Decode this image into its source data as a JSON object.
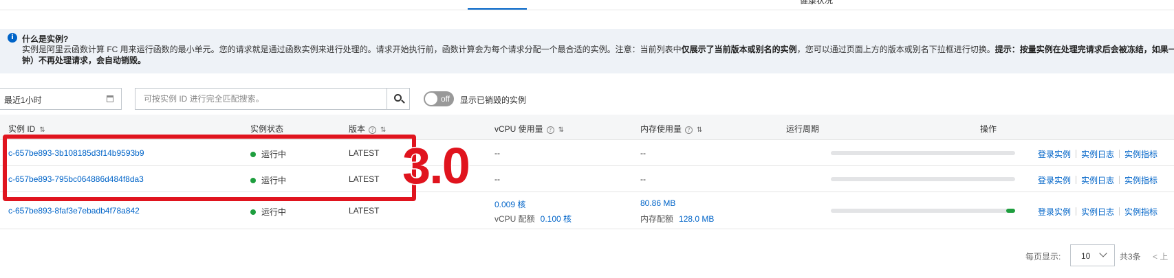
{
  "top_tabs": {
    "partial_label": "健康状况"
  },
  "info": {
    "icon": "info-icon",
    "title": "什么是实例?",
    "line1_a": "实例是阿里云函数计算 FC 用来运行函数的最小单元。您的请求就是通过函数实例来进行处理的。请求开始执行前，函数计算会为每个请求分配一个最合适的实例。注意：当前列表中",
    "line1_b": "仅展示了当前版本或别名的实例",
    "line1_c": "，您可以通过页面上方的版本或别名下拉框进行切换。",
    "line1_d": "提示：按量实例在处理完请求后会被冻结，如果一",
    "line2": "钟）不再处理请求，会自动销毁。"
  },
  "filter": {
    "time_range": "最近1小时",
    "search_placeholder": "可按实例 ID 进行完全匹配搜索。",
    "search_value": "",
    "toggle_state": "off",
    "toggle_label": "显示已销毁的实例"
  },
  "table": {
    "columns": {
      "instance_id": "实例 ID",
      "status": "实例状态",
      "version": "版本",
      "vcpu": "vCPU 使用量",
      "memory": "内存使用量",
      "lifecycle": "运行周期",
      "actions": "操作"
    },
    "rows": [
      {
        "id": "c-657be893-3b108185d3f14b9593b9",
        "status": "运行中",
        "version": "LATEST",
        "vcpu": "--",
        "memory": "--",
        "lifecycle_progress": 0
      },
      {
        "id": "c-657be893-795bc064886d484f8da3",
        "status": "运行中",
        "version": "LATEST",
        "vcpu": "--",
        "memory": "--",
        "lifecycle_progress": 0
      },
      {
        "id": "c-657be893-8faf3e7ebadb4f78a842",
        "status": "运行中",
        "version": "LATEST",
        "vcpu": "0.009 核",
        "vcpu_quota_label": "vCPU 配额",
        "vcpu_quota": "0.100 核",
        "memory": "80.86 MB",
        "memory_quota_label": "内存配额",
        "memory_quota": "128.0 MB",
        "lifecycle_progress": 0.05
      }
    ],
    "actions": {
      "login": "登录实例",
      "logs": "实例日志",
      "metrics": "实例指标"
    }
  },
  "pagination": {
    "per_page_label": "每页显示:",
    "per_page": "10",
    "total": "共3条",
    "prev": "上"
  },
  "annotation": {
    "label": "3.0",
    "color": "#e0141e"
  },
  "colors": {
    "accent": "#0064c8",
    "running": "#1e9e3e"
  }
}
